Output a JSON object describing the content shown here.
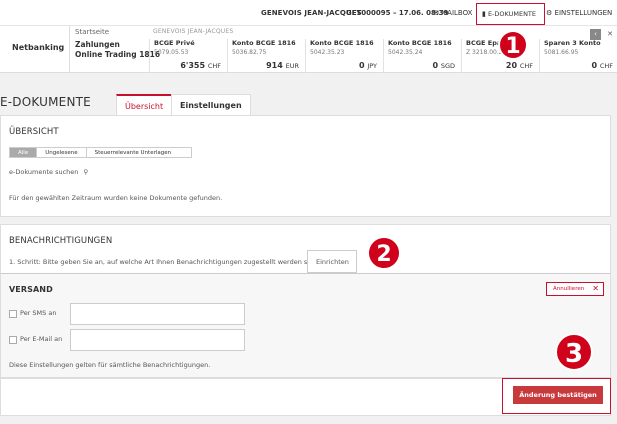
{
  "header": {
    "user": "GENEVOIS JEAN-JACQUES",
    "contract": "GET000095 – 17.06. 08:39",
    "mailbox": "MAILBOX",
    "edokumente": "E-DOKUMENTE",
    "settings": "EINSTELLUNGEN"
  },
  "strip": {
    "netbanking": "Netbanking",
    "startseite": "Startseite",
    "zahlungen_line1": "Zahlungen",
    "zahlungen_line2": "Online Trading 1816",
    "owner": "GENEVOIS JEAN-JACQUES",
    "accounts": [
      {
        "name": "BCGE Privé",
        "number": "5079.05.53",
        "amount": "6'355",
        "currency": "CHF"
      },
      {
        "name": "Konto BCGE 1816",
        "number": "5036.82.75",
        "amount": "914",
        "currency": "EUR"
      },
      {
        "name": "Konto BCGE 1816",
        "number": "5042.35.23",
        "amount": "0",
        "currency": "JPY"
      },
      {
        "name": "Konto BCGE 1816",
        "number": "5042.35.24",
        "amount": "0",
        "currency": "SGD"
      },
      {
        "name": "BCGE Epar",
        "number": "Z 3218.00.2",
        "amount": "20",
        "currency": "CHF"
      },
      {
        "name": "Sparen 3 Konto",
        "number": "5081.66.95",
        "amount": "0",
        "currency": "CHF"
      }
    ]
  },
  "page": {
    "title": "E-DOKUMENTE",
    "tabs": [
      "Übersicht",
      "Einstellungen"
    ]
  },
  "overview": {
    "title": "ÜBERSICHT",
    "filters": [
      "Alle",
      "Ungelesene",
      "Steuerrelevante Unterlagen"
    ],
    "search_label": "e-Dokumente suchen",
    "empty_text": "Für den gewählten Zeitraum wurden keine Dokumente gefunden."
  },
  "notifications": {
    "title": "BENACHRICHTIGUNGEN",
    "step_text": "1. Schritt: Bitte geben Sie an, auf welche Art Ihnen Benachrichtigungen zugestellt werden sollen",
    "einrichten": "Einrichten"
  },
  "versand": {
    "title": "VERSAND",
    "annullieren": "Annullieren",
    "sms_label": "Per SMS an",
    "sms_value": "",
    "email_label": "Per E-Mail an",
    "email_value": "",
    "note": "Diese Einstellungen gelten für sämtliche Benachrichtigungen.",
    "confirm": "Änderung bestätigen"
  },
  "callouts": [
    "1",
    "2",
    "3"
  ],
  "colors": {
    "accent": "#c8102e",
    "callout": "#d0021b"
  }
}
